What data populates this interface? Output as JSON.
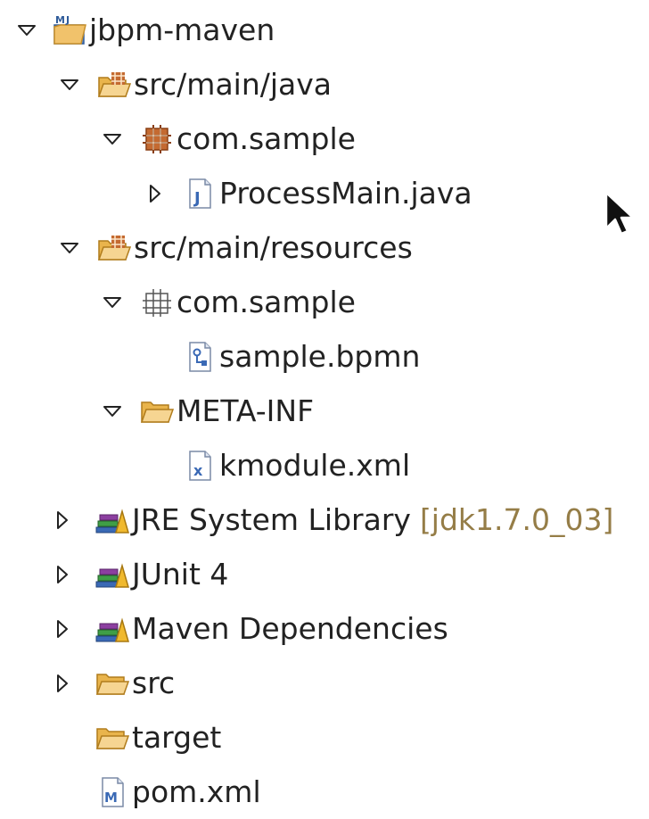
{
  "explorer": {
    "items": [
      {
        "label": "jbpm-maven",
        "icon": "maven-project-icon",
        "twisty": "expanded"
      },
      {
        "label": "src/main/java",
        "icon": "source-folder-icon",
        "twisty": "expanded"
      },
      {
        "label": "com.sample",
        "icon": "package-icon",
        "twisty": "expanded"
      },
      {
        "label": "ProcessMain.java",
        "icon": "java-file-icon",
        "twisty": "collapsed"
      },
      {
        "label": "src/main/resources",
        "icon": "source-folder-icon",
        "twisty": "expanded"
      },
      {
        "label": "com.sample",
        "icon": "empty-package-icon",
        "twisty": "expanded"
      },
      {
        "label": "sample.bpmn",
        "icon": "bpmn-file-icon",
        "twisty": "none"
      },
      {
        "label": "META-INF",
        "icon": "folder-icon",
        "twisty": "expanded"
      },
      {
        "label": "kmodule.xml",
        "icon": "xml-file-icon",
        "twisty": "none"
      },
      {
        "label": "JRE System Library",
        "decoration": "[jdk1.7.0_03]",
        "icon": "library-icon",
        "twisty": "collapsed"
      },
      {
        "label": "JUnit 4",
        "icon": "library-icon",
        "twisty": "collapsed"
      },
      {
        "label": "Maven Dependencies",
        "icon": "library-icon",
        "twisty": "collapsed"
      },
      {
        "label": "src",
        "icon": "folder-icon",
        "twisty": "collapsed"
      },
      {
        "label": "target",
        "icon": "folder-icon",
        "twisty": "none"
      },
      {
        "label": "pom.xml",
        "icon": "maven-pom-file-icon",
        "twisty": "none"
      }
    ]
  },
  "colors": {
    "text": "#222222",
    "decoration": "#957d47",
    "folder": "#e9b44c",
    "package": "#b25b2a",
    "java_file": "#3a69b5"
  }
}
